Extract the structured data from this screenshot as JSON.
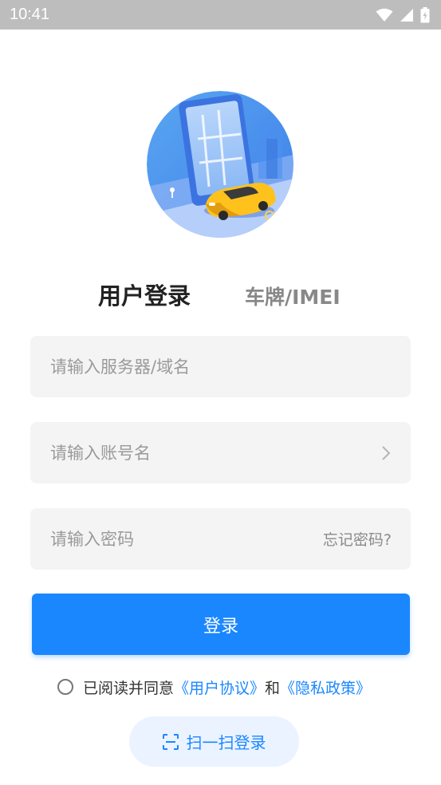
{
  "status_bar": {
    "time": "10:41",
    "icons": [
      "wifi-icon",
      "signal-icon",
      "battery-charging-icon"
    ]
  },
  "logo": {
    "icon": "car-map-illustration"
  },
  "tabs": [
    {
      "label": "用户登录",
      "active": true
    },
    {
      "label": "车牌/IMEI",
      "active": false
    }
  ],
  "form": {
    "server_placeholder": "请输入服务器/域名",
    "account_placeholder": "请输入账号名",
    "password_placeholder": "请输入密码",
    "forgot_label": "忘记密码?",
    "login_label": "登录"
  },
  "agreement": {
    "prefix": "已阅读并同意",
    "user_agreement": "《用户协议》",
    "and": "和",
    "privacy_policy": "《隐私政策》"
  },
  "scan_login": {
    "label": "扫一扫登录",
    "icon": "scan-icon"
  },
  "colors": {
    "accent": "#1b87ff",
    "status_bar": "#bdbdbd",
    "field_bg": "#f4f4f5",
    "scan_bg": "#eaf3ff"
  }
}
